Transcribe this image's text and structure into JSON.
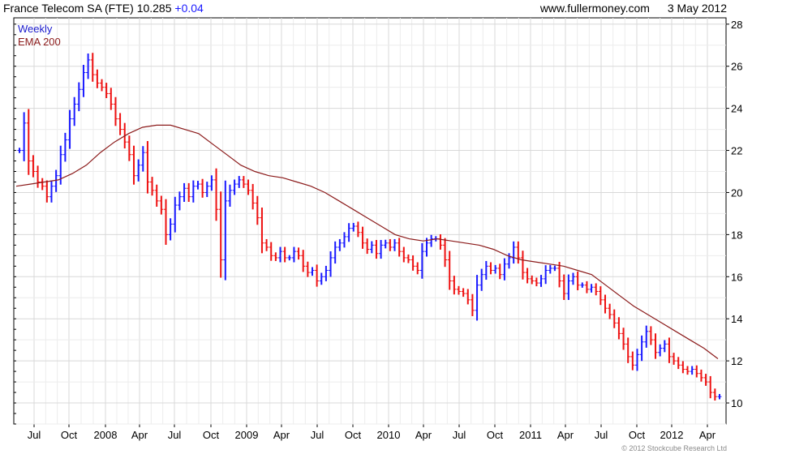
{
  "header": {
    "title": "France Telecom SA (FTE)",
    "price": "10.285",
    "change": "+0.04",
    "site": "www.fullermoney.com",
    "date": "3 May 2012"
  },
  "legend": {
    "weekly": "Weekly",
    "ema": "EMA 200"
  },
  "copyright": "© 2012 Stockcube Research Ltd",
  "colors": {
    "up": "#1a1aff",
    "down": "#ee1111",
    "ema": "#8b1a1a",
    "grid": "#d8d8d8"
  },
  "chart_data": {
    "type": "line",
    "x_tick_labels": [
      "Jul",
      "Oct",
      "2008",
      "Apr",
      "Jul",
      "Oct",
      "2009",
      "Apr",
      "Jul",
      "Oct",
      "2010",
      "Apr",
      "Jul",
      "Oct",
      "2011",
      "Apr",
      "Jul",
      "Oct",
      "2012",
      "Apr"
    ],
    "y_ticks": [
      10,
      12,
      14,
      16,
      18,
      20,
      22,
      24,
      26,
      28
    ],
    "ylim": [
      9,
      28.3
    ],
    "grid": true,
    "legend_position": "top-left",
    "series": [
      {
        "name": "Weekly",
        "style": "up/down price bars",
        "y": [
          22.0,
          23.3,
          21.5,
          21.0,
          20.5,
          20.3,
          19.8,
          20.3,
          20.8,
          21.8,
          22.5,
          23.5,
          24.2,
          24.9,
          25.7,
          26.3,
          25.6,
          25.2,
          25.0,
          24.7,
          24.2,
          23.5,
          23.0,
          22.4,
          21.8,
          20.8,
          21.3,
          21.9,
          20.5,
          20.1,
          19.6,
          19.2,
          18.0,
          18.5,
          19.4,
          19.8,
          20.2,
          19.8,
          20.3,
          20.4,
          20.0,
          20.3,
          20.6,
          19.2,
          16.8,
          19.6,
          20.1,
          20.4,
          20.6,
          20.4,
          20.1,
          19.5,
          18.8,
          17.6,
          17.4,
          17.0,
          16.9,
          17.2,
          16.9,
          16.9,
          17.2,
          17.0,
          16.5,
          16.2,
          16.3,
          15.8,
          16.0,
          16.3,
          16.9,
          17.4,
          17.6,
          17.9,
          18.3,
          18.4,
          18.1,
          17.6,
          17.3,
          17.5,
          17.1,
          17.5,
          17.6,
          17.4,
          17.6,
          17.2,
          16.9,
          16.8,
          16.5,
          16.3,
          17.2,
          17.6,
          17.8,
          17.8,
          17.5,
          16.8,
          15.8,
          15.4,
          15.3,
          15.2,
          14.9,
          14.4,
          15.6,
          16.1,
          16.5,
          16.3,
          16.4,
          16.1,
          16.6,
          16.9,
          17.4,
          16.9,
          16.2,
          15.9,
          15.8,
          15.7,
          15.9,
          16.3,
          16.4,
          16.4,
          15.8,
          15.2,
          15.8,
          16.0,
          15.6,
          15.6,
          15.4,
          15.5,
          15.3,
          14.9,
          14.5,
          14.2,
          13.8,
          13.3,
          12.8,
          12.2,
          11.8,
          12.3,
          12.9,
          13.4,
          13.0,
          12.4,
          12.6,
          12.8,
          12.2,
          12.0,
          11.8,
          11.6,
          11.5,
          11.6,
          11.4,
          11.2,
          11.0,
          10.5,
          10.3,
          10.3
        ],
        "x_start": "2007-06",
        "frequency": "weekly"
      },
      {
        "name": "EMA 200",
        "y": [
          20.3,
          20.4,
          20.5,
          20.6,
          20.9,
          21.3,
          21.9,
          22.4,
          22.8,
          23.1,
          23.2,
          23.2,
          23.0,
          22.8,
          22.3,
          21.8,
          21.3,
          21.0,
          20.8,
          20.7,
          20.5,
          20.3,
          20.0,
          19.6,
          19.2,
          18.8,
          18.4,
          18.0,
          17.8,
          17.7,
          17.8,
          17.7,
          17.6,
          17.5,
          17.3,
          17.0,
          16.8,
          16.7,
          16.6,
          16.5,
          16.3,
          16.1,
          15.6,
          15.1,
          14.6,
          14.2,
          13.8,
          13.4,
          13.0,
          12.6,
          12.1
        ]
      }
    ]
  }
}
